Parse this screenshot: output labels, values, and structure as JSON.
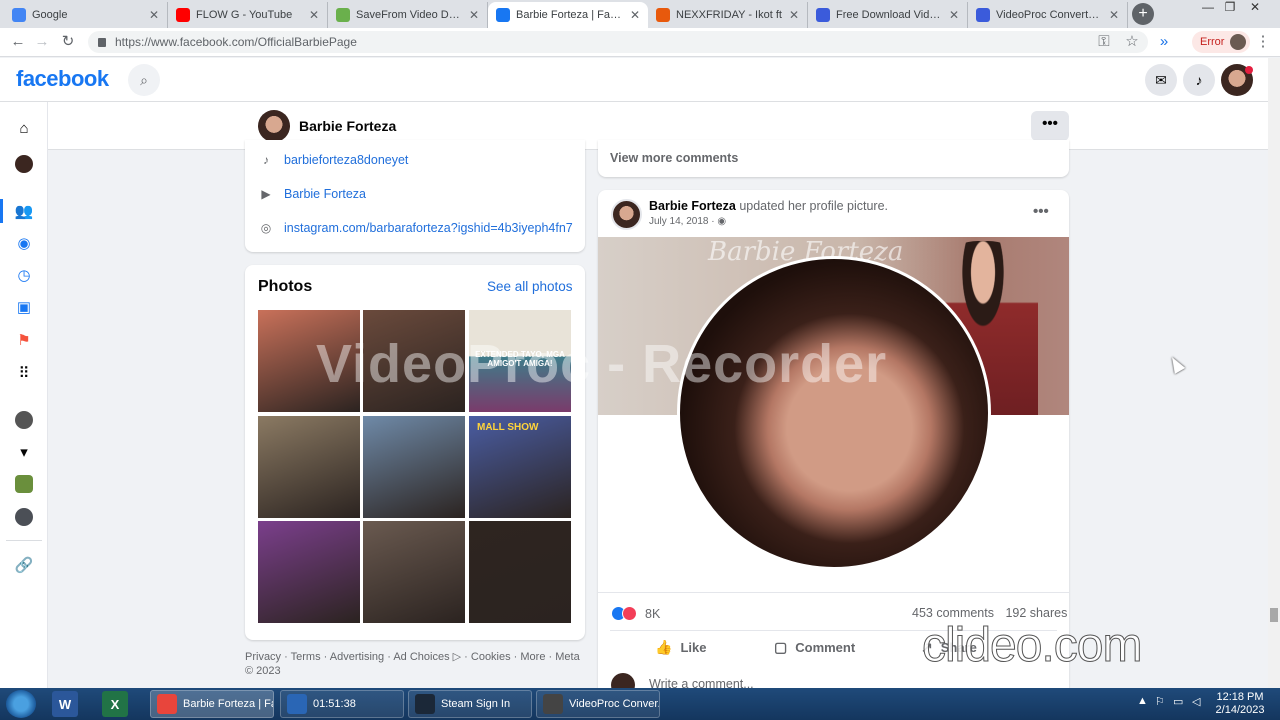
{
  "browser": {
    "tabs": [
      {
        "title": "Google",
        "favicon_color": "#4285f4"
      },
      {
        "title": "FLOW G - YouTube",
        "favicon_color": "#ff0000"
      },
      {
        "title": "SaveFrom Video Downlo",
        "favicon_color": "#6ab04c"
      },
      {
        "title": "Barbie Forteza | Facebook",
        "favicon_color": "#1877f2"
      },
      {
        "title": "NEXXFRIDAY - Ikot ft",
        "favicon_color": "#e8590c"
      },
      {
        "title": "Free Download Videos O",
        "favicon_color": "#3b5bdb"
      },
      {
        "title": "VideoProc Converter - V",
        "favicon_color": "#3b5bdb"
      }
    ],
    "new_tab_label": "+",
    "url": "https://www.facebook.com/OfficialBarbiePage",
    "error_label": "Error",
    "win_controls": [
      "—",
      "❐",
      "✕"
    ]
  },
  "facebook": {
    "logo": "facebook",
    "page_name": "Barbie Forteza",
    "more_button": "•••",
    "intro_links": [
      {
        "icon": "tiktok-icon",
        "glyph": "♪",
        "label": "barbieforteza8doneyet"
      },
      {
        "icon": "youtube-icon",
        "glyph": "▶",
        "label": "Barbie Forteza"
      },
      {
        "icon": "globe-icon",
        "glyph": "◎",
        "label": "instagram.com/barbaraforteza?igshid=4b3iyeph4fn7"
      }
    ],
    "photos": {
      "title": "Photos",
      "see_all": "See all photos",
      "caption_text_1": "EXTENDED TAYO, MGA AMIGO'T AMIGA!",
      "caption_text_2": "MALL SHOW",
      "tile_colors": [
        "#c9715a",
        "#6a4a3c",
        "#3f7c8a",
        "#8b7a63",
        "#6f8aa8",
        "#4a5da3",
        "#7b3f8c",
        "#6a5a50",
        "#2e2520"
      ]
    },
    "footer": "Privacy · Terms · Advertising · Ad Choices ▷ · Cookies · More · Meta © 2023",
    "feed": {
      "view_more_comments": "View more comments",
      "post": {
        "author": "Barbie Forteza",
        "action": " updated her profile picture.",
        "date": "July 14, 2018 · ◉",
        "menu": "•••",
        "cover_script": "Barbie Forteza",
        "reaction_count": "8K",
        "comments": "453 comments",
        "shares": "192 shares",
        "actions": {
          "like": "Like",
          "comment": "Comment",
          "share": "Share"
        },
        "write_comment": "Write a comment..."
      }
    }
  },
  "overlays": {
    "recorder_watermark": "VideoProc - Recorder",
    "clideo_watermark": "clideo.com"
  },
  "taskbar": {
    "apps": [
      {
        "label": "Barbie Forteza | Fa...",
        "icon_color": "#e8453c"
      },
      {
        "label": "01:51:38",
        "icon_color": "#2a66b5"
      },
      {
        "label": "Steam Sign In",
        "icon_color": "#1b2838"
      },
      {
        "label": "VideoProc Conver...",
        "icon_color": "#444"
      }
    ],
    "pinned": [
      {
        "letter": "W",
        "color": "#2b579a"
      },
      {
        "letter": "X",
        "color": "#217346"
      }
    ],
    "time": "12:18 PM",
    "date": "2/14/2023"
  }
}
